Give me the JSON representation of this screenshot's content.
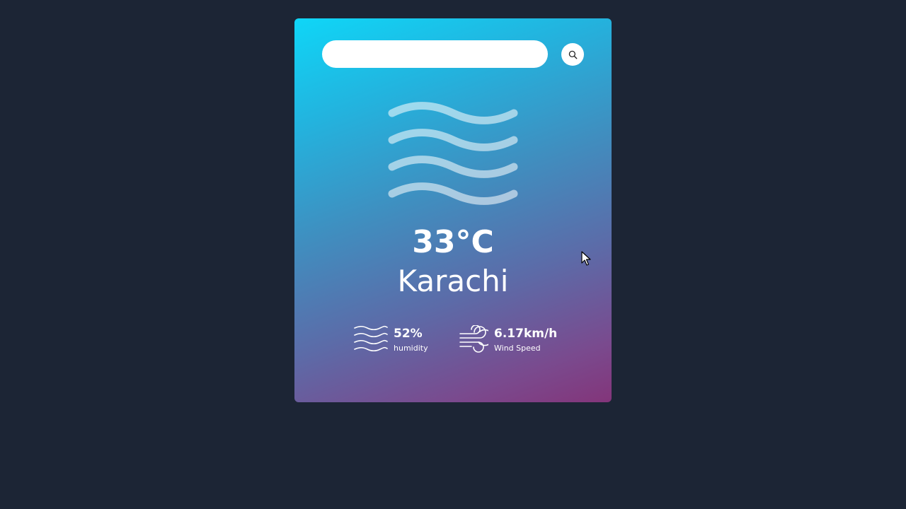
{
  "search": {
    "value": "",
    "placeholder": ""
  },
  "weather": {
    "icon": "mist-icon",
    "temperature": "33°C",
    "city": "Karachi"
  },
  "details": {
    "humidity": {
      "icon": "humidity-icon",
      "value": "52%",
      "label": "humidity"
    },
    "wind": {
      "icon": "wind-icon",
      "value": "6.17km/h",
      "label": "Wind Speed"
    }
  },
  "colors": {
    "background": "#1c2535",
    "card_gradient_start": "#0fd6f7",
    "card_gradient_end": "#83357a"
  }
}
